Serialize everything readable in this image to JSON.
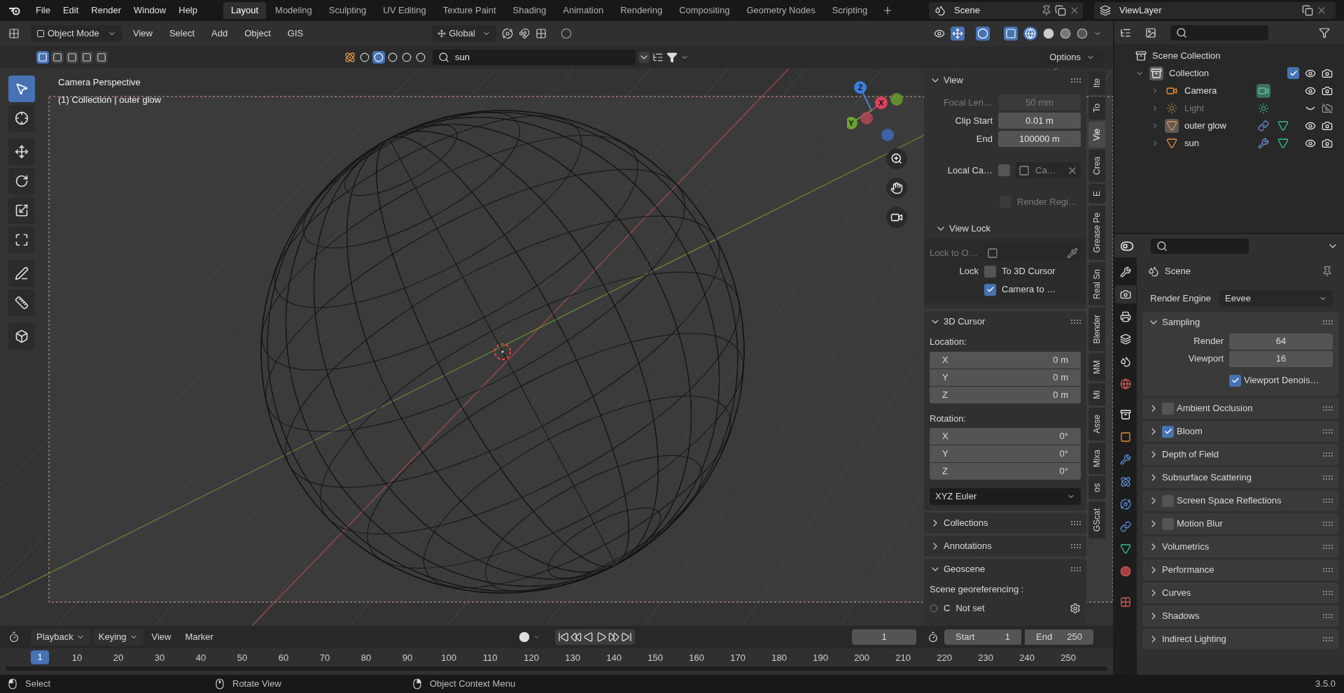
{
  "app_menu": [
    "File",
    "Edit",
    "Render",
    "Window",
    "Help"
  ],
  "workspaces": [
    {
      "label": "Layout",
      "selected": true
    },
    {
      "label": "Modeling",
      "selected": false
    },
    {
      "label": "Sculpting",
      "selected": false
    },
    {
      "label": "UV Editing",
      "selected": false
    },
    {
      "label": "Texture Paint",
      "selected": false
    },
    {
      "label": "Shading",
      "selected": false
    },
    {
      "label": "Animation",
      "selected": false
    },
    {
      "label": "Rendering",
      "selected": false
    },
    {
      "label": "Compositing",
      "selected": false
    },
    {
      "label": "Geometry Nodes",
      "selected": false
    },
    {
      "label": "Scripting",
      "selected": false
    }
  ],
  "scene": "Scene",
  "view_layer": "ViewLayer",
  "viewport_header": {
    "mode": "Object Mode",
    "menus": [
      "View",
      "Select",
      "Add",
      "Object",
      "GIS"
    ],
    "orientation": "Global"
  },
  "tool_header": {
    "search": "sun",
    "options": "Options"
  },
  "tools": [
    {
      "kind": "select",
      "selected": true
    },
    {
      "kind": "cursor",
      "selected": false
    },
    {
      "kind": "move",
      "selected": false
    },
    {
      "kind": "rotate",
      "selected": false
    },
    {
      "kind": "scale",
      "selected": false
    },
    {
      "kind": "transform",
      "selected": false
    },
    {
      "kind": "annotate",
      "selected": false
    },
    {
      "kind": "measure",
      "selected": false
    },
    {
      "kind": "add-cube",
      "selected": false
    }
  ],
  "viewport": {
    "camera_label": "Camera Perspective",
    "object_label": "(1) Collection | outer glow",
    "axes": [
      "Z",
      "X",
      "Y"
    ]
  },
  "sidebar": {
    "tabs": [
      {
        "label": "Ite",
        "selected": false
      },
      {
        "label": "To",
        "selected": false
      },
      {
        "label": "Vie",
        "selected": true
      },
      {
        "label": "Crea",
        "selected": false
      },
      {
        "label": "E",
        "selected": false
      },
      {
        "label": "Grease Pe",
        "selected": false
      },
      {
        "label": "Real Sn",
        "selected": false
      },
      {
        "label": "Blender",
        "selected": false
      },
      {
        "label": "MM",
        "selected": false
      },
      {
        "label": "Mi",
        "selected": false
      },
      {
        "label": "Asse",
        "selected": false
      },
      {
        "label": "Mixa",
        "selected": false
      },
      {
        "label": "os",
        "selected": false
      },
      {
        "label": "GScat",
        "selected": false
      }
    ],
    "view": {
      "title": "View",
      "fields": [
        {
          "label": "Focal Len…",
          "value": "50 mm",
          "disabled": true
        },
        {
          "label": "Clip Start",
          "value": "0.01 m",
          "disabled": false
        },
        {
          "label": "End",
          "value": "100000 m",
          "disabled": false
        }
      ],
      "local_camera": {
        "label": "Local Ca…",
        "checked": false,
        "value": "Ca…"
      },
      "render_region": {
        "label": "Render Regi…",
        "checked": false
      }
    },
    "view_lock": {
      "title": "View Lock",
      "lock_to": "Lock to O…",
      "lock_label": "Lock",
      "options": [
        {
          "label": "To 3D Cursor",
          "checked": false
        },
        {
          "label": "Camera to …",
          "checked": true
        }
      ]
    },
    "cursor": {
      "title": "3D Cursor",
      "location_label": "Location:",
      "location": [
        {
          "axis": "X",
          "value": "0 m"
        },
        {
          "axis": "Y",
          "value": "0 m"
        },
        {
          "axis": "Z",
          "value": "0 m"
        }
      ],
      "rotation_label": "Rotation:",
      "rotation": [
        {
          "axis": "X",
          "value": "0°"
        },
        {
          "axis": "Y",
          "value": "0°"
        },
        {
          "axis": "Z",
          "value": "0°"
        }
      ],
      "rotation_mode": "XYZ Euler"
    },
    "collapsed": [
      "Collections",
      "Annotations"
    ],
    "geoscene": {
      "title": "Geoscene",
      "label": "Scene georeferencing :",
      "crs_selected": false,
      "crs_letter": "C",
      "crs_value": "Not set"
    }
  },
  "outliner": {
    "root": "Scene Collection",
    "tree": [
      {
        "label": "Collection",
        "expanded": true,
        "active": true,
        "checked": true,
        "visible": true,
        "children": [
          {
            "label": "Camera",
            "kind": "camera",
            "expanded": false,
            "active": false,
            "visible": true,
            "icons": [
              {
                "kind": "camera-data",
                "active": true
              }
            ]
          },
          {
            "label": "Light",
            "kind": "light",
            "expanded": false,
            "active": false,
            "visible": false,
            "icons": [
              {
                "kind": "light-data",
                "active": false
              }
            ]
          },
          {
            "label": "outer glow",
            "kind": "mesh",
            "expanded": false,
            "active": true,
            "visible": true,
            "icons": [
              {
                "kind": "constraint",
                "active": false
              },
              {
                "kind": "mesh-data",
                "active": false
              }
            ]
          },
          {
            "label": "sun",
            "kind": "mesh",
            "expanded": false,
            "active": false,
            "visible": true,
            "icons": [
              {
                "kind": "modifier",
                "active": false
              },
              {
                "kind": "mesh-data",
                "active": false
              }
            ]
          }
        ]
      }
    ]
  },
  "properties": {
    "title": "Scene",
    "tabs": [
      {
        "kind": "tool",
        "selected": false
      },
      {
        "kind": "render",
        "selected": true
      },
      {
        "kind": "output",
        "selected": false
      },
      {
        "kind": "view-layer",
        "selected": false
      },
      {
        "kind": "scene",
        "selected": false
      },
      {
        "kind": "world",
        "selected": false
      },
      {
        "kind": "collection",
        "selected": false
      },
      {
        "kind": "object",
        "selected": false
      },
      {
        "kind": "modifier",
        "selected": false
      },
      {
        "kind": "particles",
        "selected": false
      },
      {
        "kind": "physics",
        "selected": false
      },
      {
        "kind": "constraint",
        "selected": false
      },
      {
        "kind": "data",
        "selected": false
      },
      {
        "kind": "material",
        "selected": false
      },
      {
        "kind": "texture",
        "selected": false
      }
    ],
    "render_engine_label": "Render Engine",
    "render_engine": "Eevee",
    "sampling": {
      "title": "Sampling",
      "fields": [
        {
          "label": "Render",
          "value": "64"
        },
        {
          "label": "Viewport",
          "value": "16"
        }
      ],
      "denoise": {
        "label": "Viewport Denois…",
        "checked": true
      }
    },
    "panels": [
      {
        "label": "Ambient Occlusion",
        "kind": "checkbox",
        "checked": false
      },
      {
        "label": "Bloom",
        "kind": "checkbox",
        "checked": true
      },
      {
        "label": "Depth of Field",
        "kind": "plain"
      },
      {
        "label": "Subsurface Scattering",
        "kind": "plain"
      },
      {
        "label": "Screen Space Reflections",
        "kind": "checkbox",
        "checked": false
      },
      {
        "label": "Motion Blur",
        "kind": "checkbox",
        "checked": false
      },
      {
        "label": "Volumetrics",
        "kind": "plain"
      },
      {
        "label": "Performance",
        "kind": "plain"
      },
      {
        "label": "Curves",
        "kind": "plain"
      },
      {
        "label": "Shadows",
        "kind": "plain"
      },
      {
        "label": "Indirect Lighting",
        "kind": "plain"
      }
    ]
  },
  "timeline": {
    "menus": [
      "Playback",
      "Keying",
      "View",
      "Marker"
    ],
    "current_frame": "1",
    "start_label": "Start",
    "start": "1",
    "end_label": "End",
    "end": "250",
    "playhead": "1",
    "ruler": [
      "10",
      "20",
      "30",
      "40",
      "50",
      "60",
      "70",
      "80",
      "90",
      "100",
      "110",
      "120",
      "130",
      "140",
      "150",
      "160",
      "170",
      "180",
      "190",
      "200",
      "210",
      "220",
      "230",
      "240",
      "250"
    ]
  },
  "status": [
    {
      "kind": "left",
      "label": "Select"
    },
    {
      "kind": "middle",
      "label": "Rotate View"
    },
    {
      "kind": "right",
      "label": "Object Context Menu"
    }
  ],
  "version": "3.5.0"
}
